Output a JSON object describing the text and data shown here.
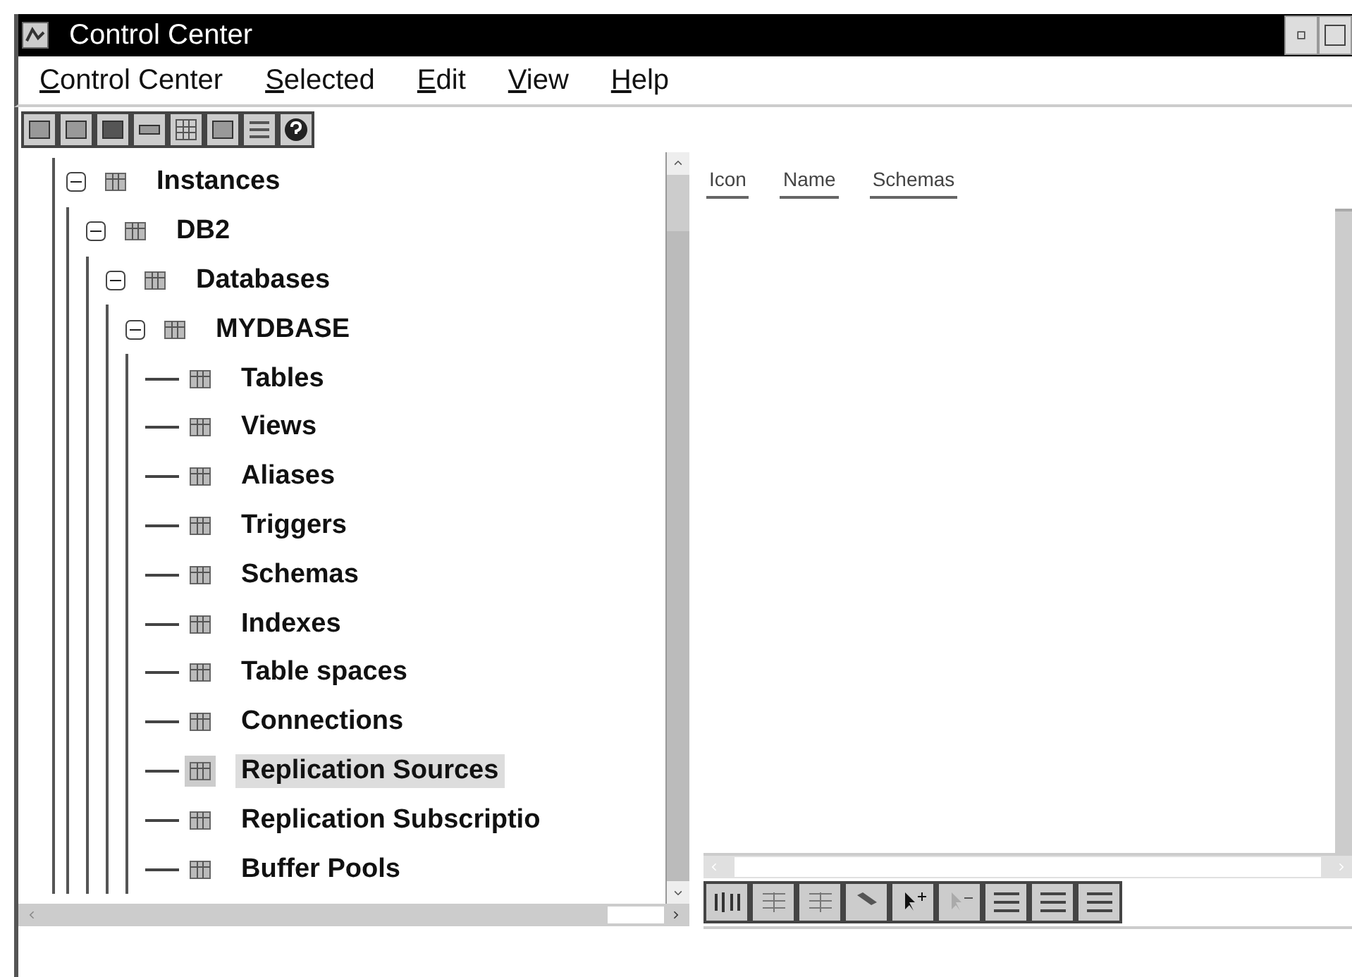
{
  "window": {
    "title": "Control Center"
  },
  "menu": [
    "Control Center",
    "Selected",
    "Edit",
    "View",
    "Help"
  ],
  "tree": [
    {
      "label": "Instances",
      "expanded": true,
      "selected": false,
      "children": [
        {
          "label": "DB2",
          "expanded": true,
          "selected": false,
          "children": [
            {
              "label": "Databases",
              "expanded": true,
              "selected": false,
              "children": [
                {
                  "label": "MYDBASE",
                  "expanded": true,
                  "selected": false,
                  "children": [
                    {
                      "label": "Tables",
                      "selected": false
                    },
                    {
                      "label": "Views",
                      "selected": false
                    },
                    {
                      "label": "Aliases",
                      "selected": false
                    },
                    {
                      "label": "Triggers",
                      "selected": false
                    },
                    {
                      "label": "Schemas",
                      "selected": false
                    },
                    {
                      "label": "Indexes",
                      "selected": false
                    },
                    {
                      "label": "Table spaces",
                      "selected": false
                    },
                    {
                      "label": "Connections",
                      "selected": false
                    },
                    {
                      "label": "Replication Sources",
                      "selected": true
                    },
                    {
                      "label": "Replication Subscriptio",
                      "selected": false
                    },
                    {
                      "label": "Buffer Pools",
                      "selected": false
                    }
                  ]
                }
              ]
            }
          ]
        }
      ]
    }
  ],
  "contents": {
    "columns": [
      "Icon",
      "Name",
      "Schemas"
    ]
  }
}
